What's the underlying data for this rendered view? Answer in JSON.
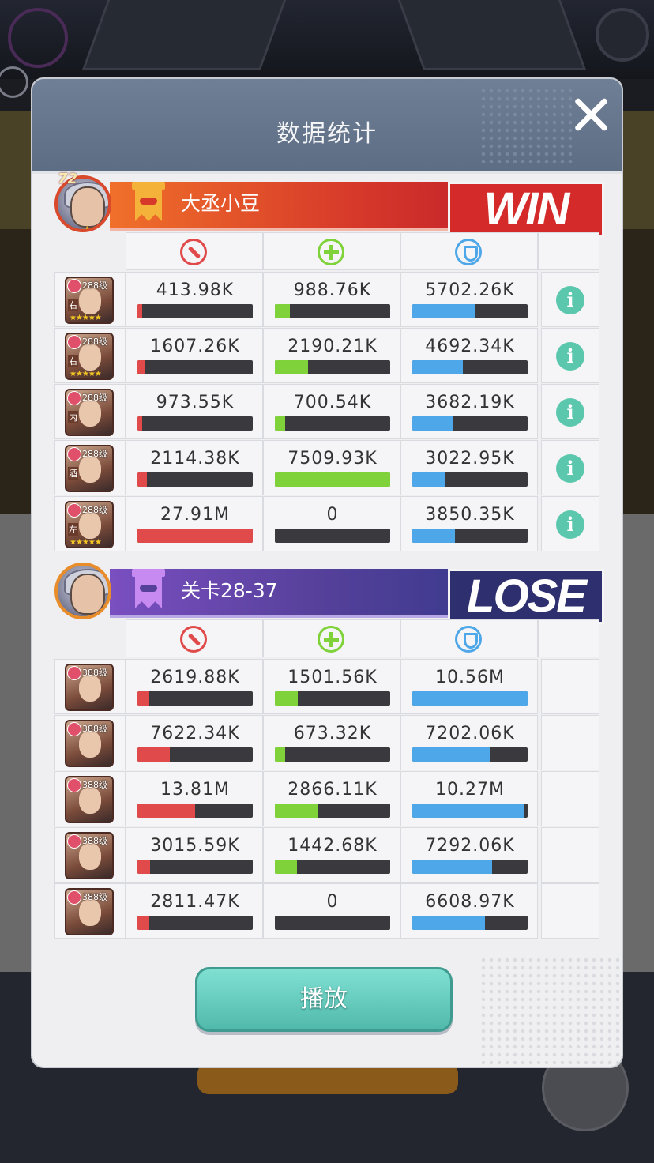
{
  "dialog": {
    "title": "数据统计"
  },
  "play_label": "播放",
  "teams": [
    {
      "leader_level": "72",
      "name": "大丞小豆",
      "result": "WIN",
      "rows": [
        {
          "tag": "右",
          "level": "288级",
          "stars": "★★★★★",
          "damage": "413.98K",
          "damage_pct": 0.04,
          "heal": "988.76K",
          "heal_pct": 0.13,
          "shield": "5702.26K",
          "shield_pct": 0.54
        },
        {
          "tag": "右",
          "level": "288级",
          "stars": "★★★★★",
          "damage": "1607.26K",
          "damage_pct": 0.06,
          "heal": "2190.21K",
          "heal_pct": 0.29,
          "shield": "4692.34K",
          "shield_pct": 0.44
        },
        {
          "tag": "内",
          "level": "288级",
          "stars": "",
          "damage": "973.55K",
          "damage_pct": 0.04,
          "heal": "700.54K",
          "heal_pct": 0.09,
          "shield": "3682.19K",
          "shield_pct": 0.35
        },
        {
          "tag": "酒",
          "level": "288级",
          "stars": "",
          "damage": "2114.38K",
          "damage_pct": 0.08,
          "heal": "7509.93K",
          "heal_pct": 1.0,
          "shield": "3022.95K",
          "shield_pct": 0.29
        },
        {
          "tag": "左",
          "level": "288级",
          "stars": "★★★★★",
          "damage": "27.91M",
          "damage_pct": 1.0,
          "heal": "0",
          "heal_pct": 0,
          "shield": "3850.35K",
          "shield_pct": 0.37
        }
      ]
    },
    {
      "name": "关卡28-37",
      "result": "LOSE",
      "rows": [
        {
          "level": "388级",
          "damage": "2619.88K",
          "damage_pct": 0.1,
          "heal": "1501.56K",
          "heal_pct": 0.2,
          "shield": "10.56M",
          "shield_pct": 1.0
        },
        {
          "level": "388级",
          "damage": "7622.34K",
          "damage_pct": 0.28,
          "heal": "673.32K",
          "heal_pct": 0.09,
          "shield": "7202.06K",
          "shield_pct": 0.68
        },
        {
          "level": "388级",
          "damage": "13.81M",
          "damage_pct": 0.5,
          "heal": "2866.11K",
          "heal_pct": 0.38,
          "shield": "10.27M",
          "shield_pct": 0.97
        },
        {
          "level": "388级",
          "damage": "3015.59K",
          "damage_pct": 0.11,
          "heal": "1442.68K",
          "heal_pct": 0.19,
          "shield": "7292.06K",
          "shield_pct": 0.69
        },
        {
          "level": "388级",
          "damage": "2811.47K",
          "damage_pct": 0.1,
          "heal": "0",
          "heal_pct": 0,
          "shield": "6608.97K",
          "shield_pct": 0.63
        }
      ]
    }
  ],
  "colors": {
    "damage": "#e04a4a",
    "heal": "#7fd23a",
    "shield": "#4ea7e8",
    "win": "#d42a2a",
    "lose": "#2e2f6e",
    "play": "#5fc9bb"
  }
}
